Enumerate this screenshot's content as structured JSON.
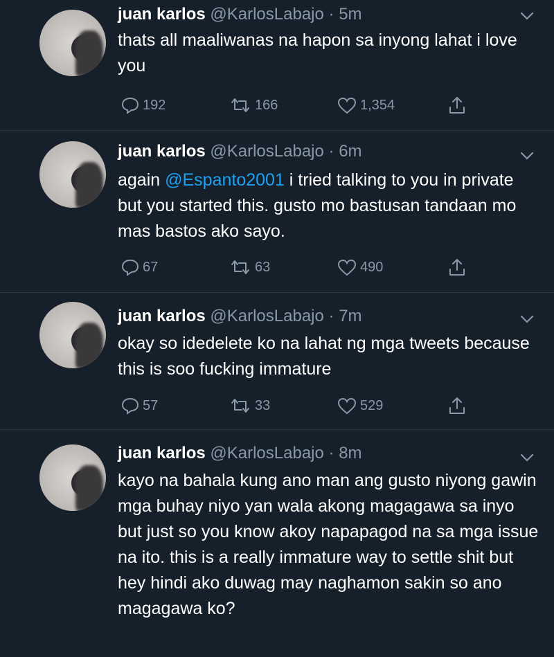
{
  "tweets": [
    {
      "name": "juan karlos",
      "handle": "@KarlosLabajo",
      "separator": "·",
      "time": "5m",
      "text_before": "thats all maaliwanas na hapon sa inyong lahat i love you",
      "mention": "",
      "text_after": "",
      "replies": "192",
      "retweets": "166",
      "likes": "1,354"
    },
    {
      "name": "juan karlos",
      "handle": "@KarlosLabajo",
      "separator": "·",
      "time": "6m",
      "text_before": "again ",
      "mention": "@Espanto2001",
      "text_after": " i tried talking to you in private but you started this. gusto mo bastusan tandaan mo mas bastos ako sayo.",
      "replies": "67",
      "retweets": "63",
      "likes": "490"
    },
    {
      "name": "juan karlos",
      "handle": "@KarlosLabajo",
      "separator": "·",
      "time": "7m",
      "text_before": "okay so idedelete ko na lahat ng mga tweets because this is soo fucking immature",
      "mention": "",
      "text_after": "",
      "replies": "57",
      "retweets": "33",
      "likes": "529"
    },
    {
      "name": "juan karlos",
      "handle": "@KarlosLabajo",
      "separator": "·",
      "time": "8m",
      "text_before": "kayo na bahala kung ano man ang gusto niyong gawin mga buhay niyo yan wala akong magagawa sa inyo but just so you know akoy napapagod na sa mga issue na ito. this is a really immature way to settle shit but hey hindi ako duwag may naghamon sakin so ano magagawa ko?",
      "mention": "",
      "text_after": ""
    }
  ],
  "colors": {
    "background": "#15202b",
    "secondary_text": "#8899a6",
    "mention": "#1da1f2",
    "divider": "#2c3a47"
  },
  "icons": [
    "reply-icon",
    "retweet-icon",
    "like-icon",
    "share-icon",
    "chevron-down-icon"
  ]
}
